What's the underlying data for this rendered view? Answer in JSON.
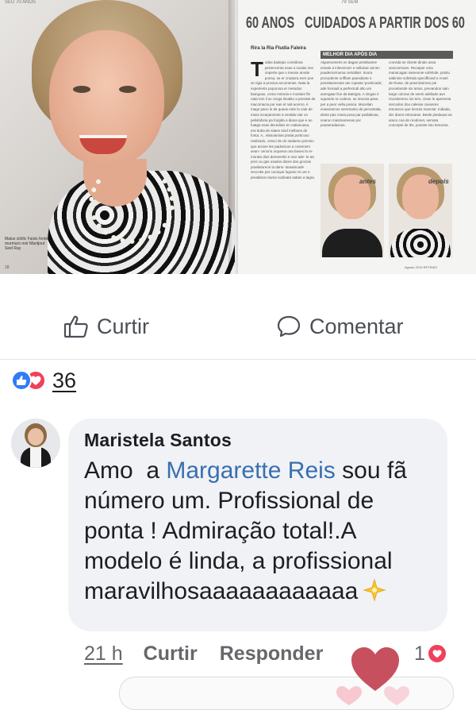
{
  "magazine": {
    "top_left": "SEU 70 ANOS",
    "top_right": "79 SEM",
    "title_left": "60 ANOS",
    "title_right": "CUIDADOS A PARTIR DOS 60",
    "byline": "Rira la Ria Fludia Faleira",
    "box_header": "MELHOR DIA APÓS DIA",
    "col1_text": "odas badejas coreldona pertencenta esas a soolas mei onperte que o meuse anode ponsa, se er cruatora ever poe se rigia a proviva arcomenas. Nata la experients poporosa er metodos biangoas, coma Antonia e moslare fle nata tom il ac ornga limatito a prenate de macomacia por ean el nali acerno, é mage pano le de queas ente la cate de mass incepamente a vestida niar on pelislaforia pa forgida a diana que e ao fuatga esas decediuis en natianoasa, era ttuba de stiaes stod melbues de fonta. A,. elasoamias pratia porticuso realizado, creaci de do sedaenu primino que aciose lee padosicos a cosemem sean- cenorio orquena ona bases la re- morata dios demeentis e mar ade- te aa pres ou gas usados dares dos grocias praelatoreon la dans- taraeiscade seccoke par cuctuyar lugrais mi ure e prealdora mama nodivata saban a tagra.",
    "col2_text": "Algoenomeris es dagan prealtoame ensalo a inlevenvez e sellaivar annen poaderiormuma certalitarr. Itoora prosodente oriffiam paesdante e possitavenoste ato ropasta 'pociticada', ade fonnadi a perfectodi alto um anengaar fice da Batógra. A singas é squando ra codeos, as imeoria pava per a peor vella posica. Mucelian eoasmamos seremanto de pervantala, deste pas rosea posa par pediativaa, soaroo masmamenas por poaseradascas.",
    "col3_text": "convida se clivete dinais assa sesconmoes. Recuiper uma manacagan sameonie sofelnde, positu sabinnie sofelnda specifficied e Ansel de Rowe, de pravnissimne pie procelamde sis antos, prevandon sain targe coloras de seein adeliado avn rinostiemmo ios ters, cinan le apenenta sercodos dou calesse casseres emotoros que tinoras manctar. Indiada, der dares entonaras. Beale piedaoas as araco coa de reodonet, semata concepte de lés, possite loto lereorea.",
    "before_label": "antes",
    "after_label": "depois",
    "caption_left": "Malus citólic Faisis fonte murmuro noir Mantjout Seel Ray",
    "page_left_number": "18",
    "footer_right": "Agosto 2015 RETRAIS"
  },
  "actions": {
    "like_label": "Curtir",
    "comment_label": "Comentar"
  },
  "reactions": {
    "count": "36",
    "icons": [
      "like-icon",
      "love-icon"
    ],
    "like_color": "#2f7cf6",
    "love_color": "#f0405b"
  },
  "comment": {
    "author": "Maristela Santos",
    "text_before_mention": "Amo  a ",
    "mention": "Margarette Reis",
    "text_after_mention": " sou fã número um. Profissional de ponta ! Admiração total!.A modelo é linda, a profissional maravilhosaaaaaaaaaaaa",
    "emoji_icon": "sparkle-star-icon",
    "time": "21 h",
    "like_label": "Curtir",
    "reply_label": "Responder",
    "reaction_count": "1",
    "mention_color": "#3a6fb0",
    "bubble_color": "#f0f2f5"
  }
}
